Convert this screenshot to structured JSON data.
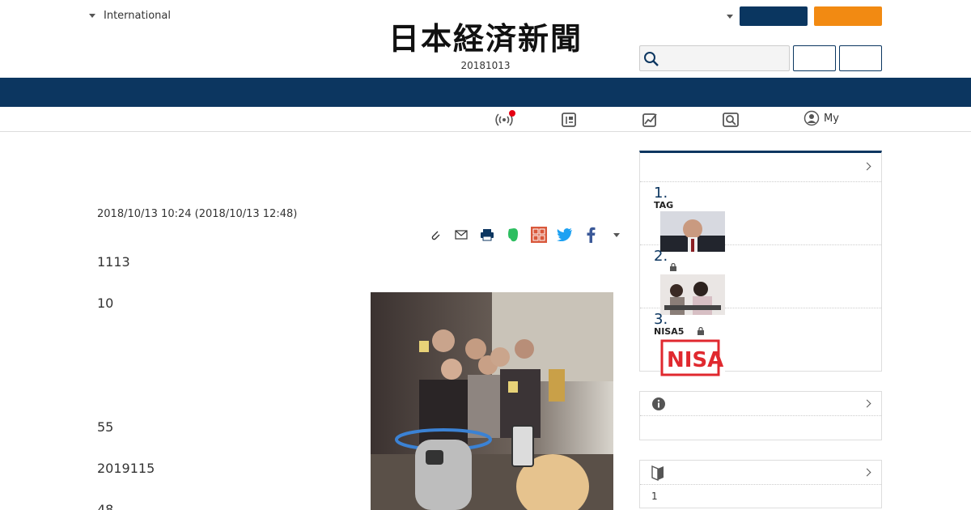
{
  "header": {
    "region_label": "International",
    "masthead_title": "日本経済新聞",
    "masthead_date": "20181013",
    "search_placeholder": "",
    "my_label": "My"
  },
  "article": {
    "date": "2018/10/13 10:24 (2018/10/13 12:48)",
    "paragraphs": [
      "1113",
      "10",
      "55",
      "2019115",
      "48"
    ]
  },
  "sidebar": {
    "ranking": [
      {
        "num": "1.",
        "tag": "TAG"
      },
      {
        "num": "2.",
        "tag": ""
      },
      {
        "num": "3.",
        "tag": "NISA5"
      }
    ],
    "box3_text": "1"
  },
  "colors": {
    "navy": "#0c3660",
    "orange": "#f28a12",
    "red_dot": "#e50012"
  }
}
